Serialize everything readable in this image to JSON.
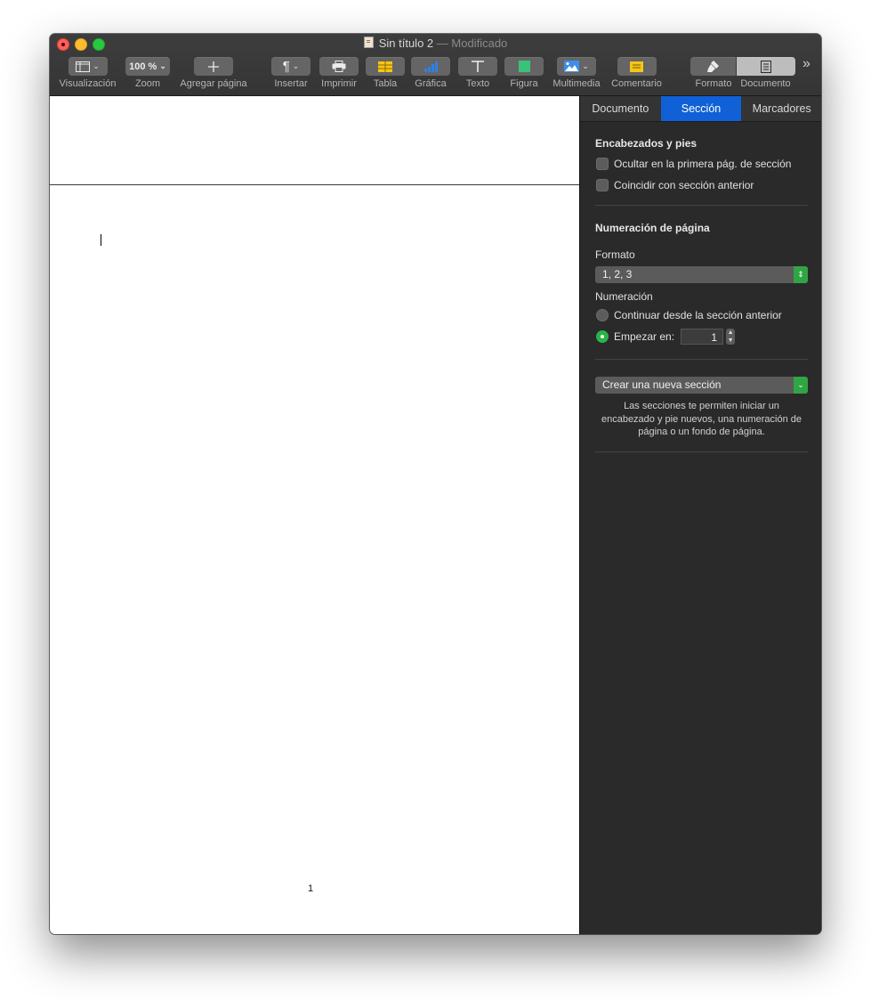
{
  "window": {
    "title": "Sin título 2",
    "title_separator": "—",
    "title_status": "Modificado"
  },
  "toolbar": {
    "view": {
      "label": "Visualización",
      "icon": "sidebar-view-icon"
    },
    "zoom": {
      "label": "Zoom",
      "value": "100 %"
    },
    "add_page": {
      "label": "Agregar página",
      "icon": "plus-icon"
    },
    "insert": {
      "label": "Insertar",
      "icon": "pilcrow-icon"
    },
    "print": {
      "label": "Imprimir",
      "icon": "printer-icon"
    },
    "table": {
      "label": "Tabla",
      "icon": "table-icon"
    },
    "chart": {
      "label": "Gráfica",
      "icon": "bar-chart-icon"
    },
    "text": {
      "label": "Texto",
      "icon": "text-T-icon"
    },
    "shape": {
      "label": "Figura",
      "icon": "square-shape-icon"
    },
    "media": {
      "label": "Multimedia",
      "icon": "image-icon"
    },
    "comment": {
      "label": "Comentario",
      "icon": "comment-note-icon"
    },
    "format": {
      "label": "Formato",
      "icon": "paintbrush-icon"
    },
    "document": {
      "label": "Documento",
      "icon": "document-icon"
    },
    "more": {
      "icon": "double-chevron-right-icon",
      "glyph": "»"
    }
  },
  "page": {
    "footer_page_number": "1"
  },
  "inspector": {
    "tabs": [
      "Documento",
      "Sección",
      "Marcadores"
    ],
    "active_tab": "Sección",
    "headers_footers": {
      "title": "Encabezados y pies",
      "hide_on_first": {
        "label": "Ocultar en la primera pág. de sección",
        "checked": false
      },
      "match_previous": {
        "label": "Coincidir con sección anterior",
        "checked": false
      }
    },
    "page_numbering": {
      "title": "Numeración de página",
      "format_label": "Formato",
      "format_value": "1, 2, 3",
      "numbering_label": "Numeración",
      "continue_option": {
        "label": "Continuar desde la sección anterior",
        "selected": false
      },
      "start_at_option": {
        "label": "Empezar en:",
        "selected": true,
        "value": "1"
      }
    },
    "new_section": {
      "button_label": "Crear una nueva sección",
      "description": "Las secciones te permiten iniciar un encabezado y pie nuevos, una numeración de página o un fondo de página."
    }
  },
  "colors": {
    "accent_tab": "#1060d7",
    "accent_green": "#2fa544",
    "inspector_bg": "#2a2a2a",
    "toolbar_bg": "#383838"
  }
}
